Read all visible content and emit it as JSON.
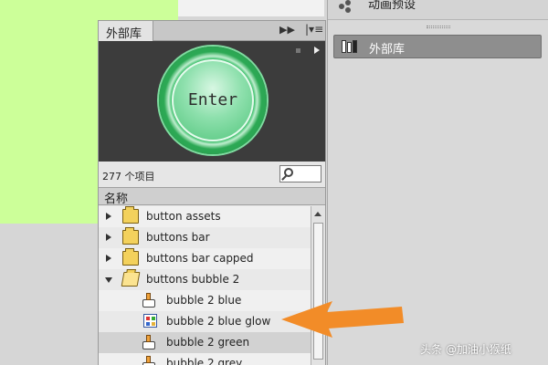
{
  "side_panel": {
    "top_label": "动画预设",
    "item_label": "外部库"
  },
  "library": {
    "tab_title": "外部库",
    "preview_button_label": "Enter",
    "item_count": "277 个项目",
    "column_header": "名称",
    "items": [
      {
        "label": "button assets",
        "type": "folder",
        "expanded": false
      },
      {
        "label": "buttons bar",
        "type": "folder",
        "expanded": false
      },
      {
        "label": "buttons bar capped",
        "type": "folder",
        "expanded": false
      },
      {
        "label": "buttons bubble 2",
        "type": "folder",
        "expanded": true
      },
      {
        "label": "bubble 2 blue",
        "type": "button-symbol"
      },
      {
        "label": "bubble 2 blue glow",
        "type": "bitmap"
      },
      {
        "label": "bubble 2 green",
        "type": "button-symbol",
        "selected": true
      },
      {
        "label": "bubble 2 grey",
        "type": "button-symbol"
      }
    ]
  },
  "annotation": {
    "arrow_color": "#f28c28"
  },
  "watermark": "头条 @加油小猴纸",
  "colors": {
    "stage_green": "#ccff99",
    "enter_green": "#3cbf6a"
  }
}
